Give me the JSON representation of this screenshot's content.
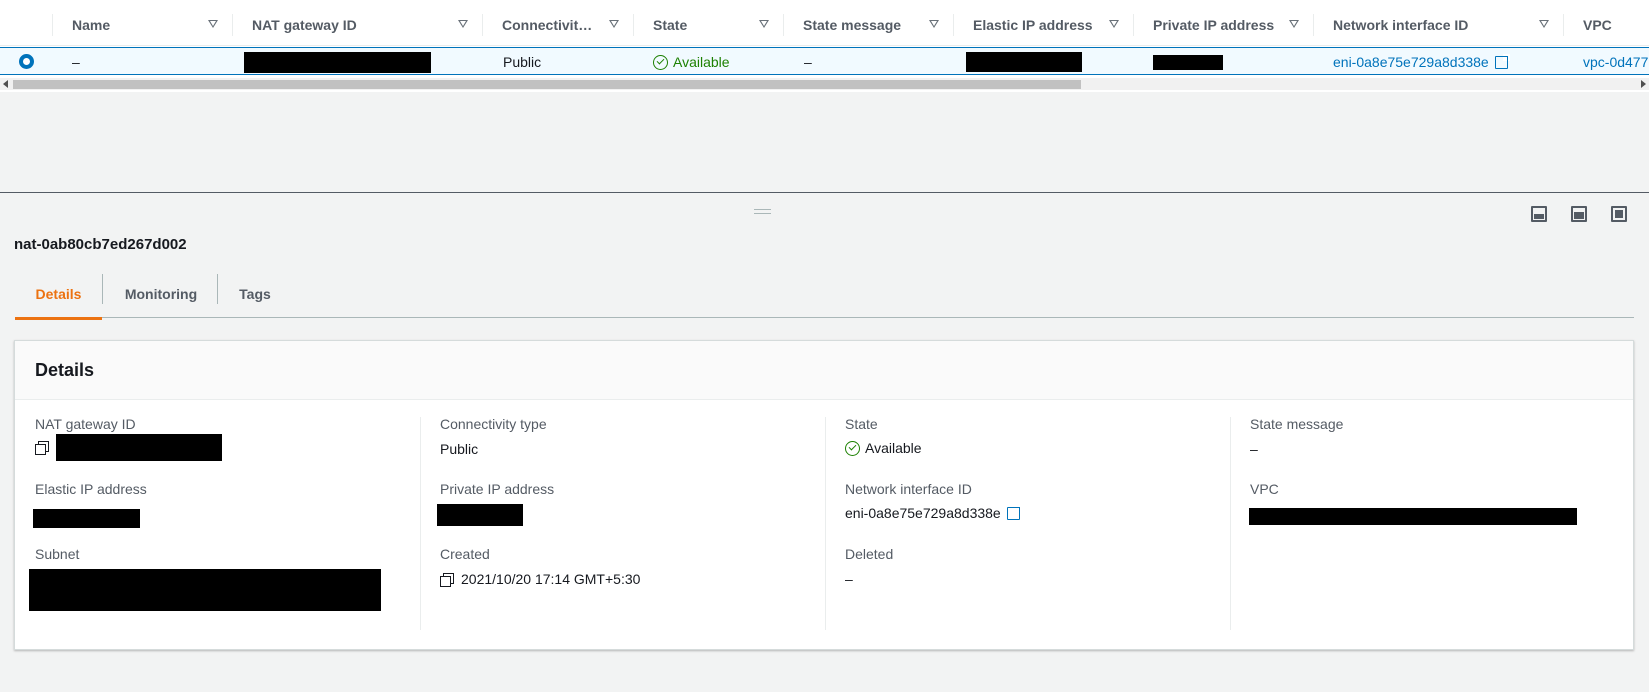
{
  "table": {
    "columns": [
      {
        "key": "name",
        "label": "Name"
      },
      {
        "key": "nat_id",
        "label": "NAT gateway ID"
      },
      {
        "key": "connectivity",
        "label": "Connectivit…"
      },
      {
        "key": "state",
        "label": "State"
      },
      {
        "key": "state_message",
        "label": "State message"
      },
      {
        "key": "eip",
        "label": "Elastic IP address"
      },
      {
        "key": "private_ip",
        "label": "Private IP address"
      },
      {
        "key": "eni",
        "label": "Network interface ID"
      },
      {
        "key": "vpc",
        "label": "VPC"
      }
    ],
    "row": {
      "name": "–",
      "connectivity": "Public",
      "state": "Available",
      "state_message": "–",
      "eni": "eni-0a8e75e729a8d338e",
      "vpc": "vpc-0d477"
    }
  },
  "panel": {
    "title": "nat-0ab80cb7ed267d002",
    "tabs": [
      "Details",
      "Monitoring",
      "Tags"
    ],
    "active_tab": "Details"
  },
  "details": {
    "heading": "Details",
    "nat_gateway_id_label": "NAT gateway ID",
    "connectivity_label": "Connectivity type",
    "connectivity_value": "Public",
    "state_label": "State",
    "state_value": "Available",
    "state_message_label": "State message",
    "state_message_value": "–",
    "eip_label": "Elastic IP address",
    "private_ip_label": "Private IP address",
    "eni_label": "Network interface ID",
    "eni_value": "eni-0a8e75e729a8d338e",
    "vpc_label": "VPC",
    "subnet_label": "Subnet",
    "created_label": "Created",
    "created_value": "2021/10/20 17:14 GMT+5:30",
    "deleted_label": "Deleted",
    "deleted_value": "–"
  },
  "colors": {
    "link": "#0073bb",
    "success": "#1d8102",
    "active_tab": "#ec7211"
  }
}
